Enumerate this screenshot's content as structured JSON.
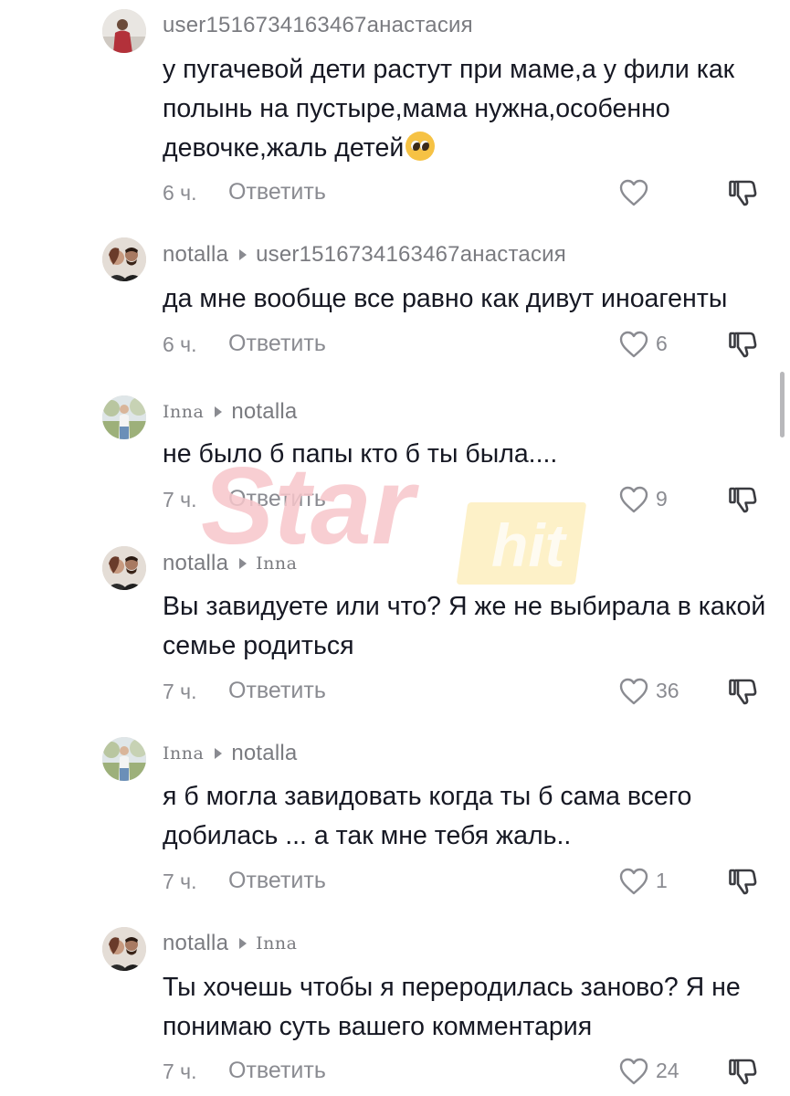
{
  "comments": [
    {
      "author": "user1516734163467анастасия",
      "reply_to": "",
      "text": "у пугачевой дети растут при маме,а у фили как полынь на пустыре,мама нужна,особенно девочке,жаль детей",
      "has_emoji": true,
      "emoji": "pleading-face",
      "time": "6 ч.",
      "reply_label": "Ответить",
      "likes": ""
    },
    {
      "author": "notalla",
      "reply_to": "user1516734163467анастасия",
      "text": "да мне вообще все равно как дивут иноагенты",
      "time": "6 ч.",
      "reply_label": "Ответить",
      "likes": "6"
    },
    {
      "author": "Inna",
      "reply_to": "notalla",
      "text": "не было б папы кто б ты была....",
      "time": "7 ч.",
      "reply_label": "Ответить",
      "likes": "9"
    },
    {
      "author": "notalla",
      "reply_to": "Inna",
      "text": "Вы завидуете или что? Я же не выбирала в какой семье родиться",
      "time": "7 ч.",
      "reply_label": "Ответить",
      "likes": "36"
    },
    {
      "author": "Inna",
      "reply_to": "notalla",
      "text": "я б могла завидовать когда ты б сама всего добилась ... а так мне тебя жаль..",
      "time": "7 ч.",
      "reply_label": "Ответить",
      "likes": "1"
    },
    {
      "author": "notalla",
      "reply_to": "Inna",
      "text": "Ты хочешь чтобы я переродилась заново? Я не понимаю суть вашего комментария",
      "time": "7 ч.",
      "reply_label": "Ответить",
      "likes": "24"
    }
  ],
  "watermark": {
    "brand": "Star",
    "sub": "hit"
  },
  "colors": {
    "text": "#161823",
    "secondary": "#8a8b91",
    "watermark_pink": "#f7c6cb",
    "watermark_yellow": "#fbe7a3"
  },
  "icons": {
    "like": "heart-outline-icon",
    "dislike": "thumbs-down-icon",
    "reply_arrow": "triangle-right-icon"
  }
}
